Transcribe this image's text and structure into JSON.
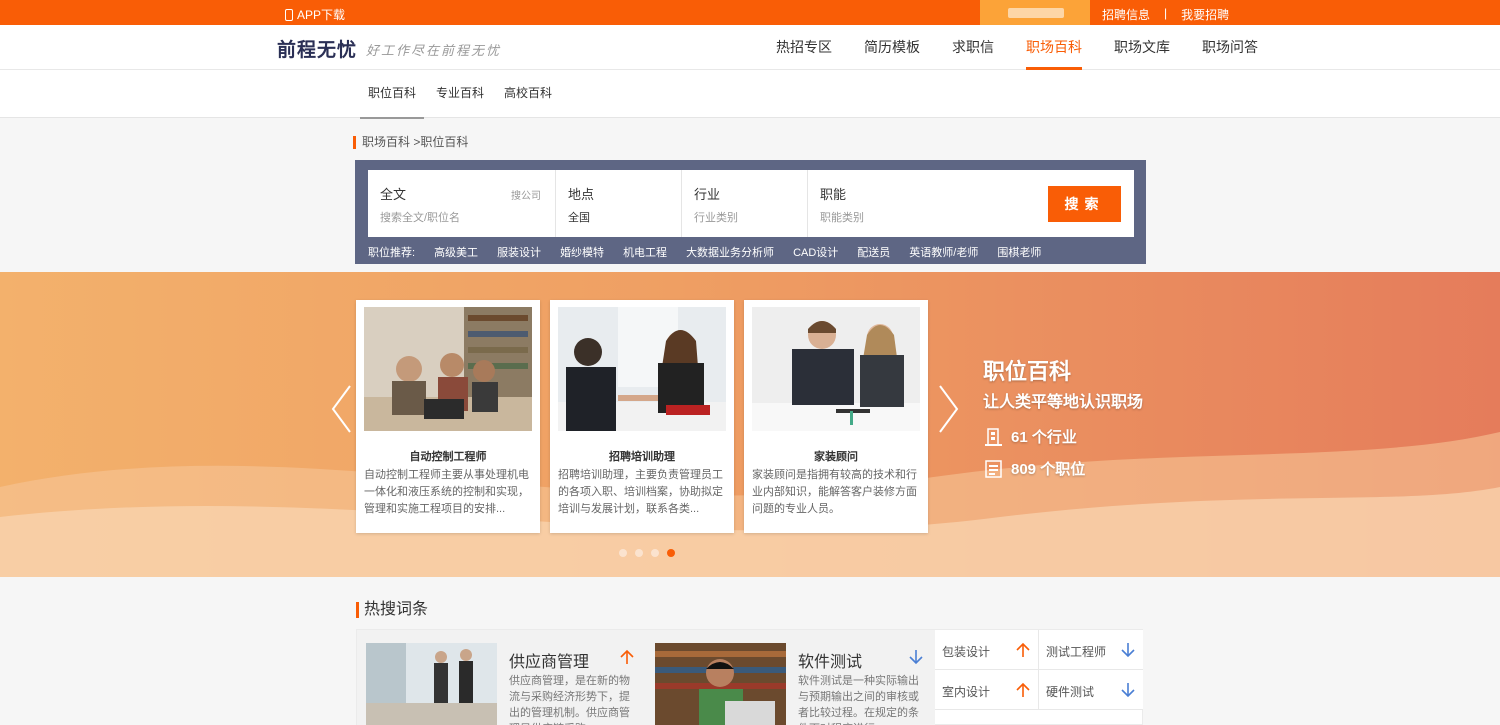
{
  "topbar": {
    "app_download": "APP下载",
    "links": [
      "招聘信息",
      "|",
      "我要招聘"
    ]
  },
  "header": {
    "logo": "前程无忧",
    "slogan": "好工作尽在前程无忧",
    "nav": [
      "热招专区",
      "简历模板",
      "求职信",
      "职场百科",
      "职场文库",
      "职场问答"
    ],
    "active_nav": "职场百科"
  },
  "subtabs": [
    "职位百科",
    "专业百科",
    "高校百科"
  ],
  "breadcrumb": "职场百科 >职位百科",
  "search": {
    "fulltext_label": "全文",
    "fulltext_aside": "搜公司",
    "fulltext_placeholder": "搜索全文/职位名",
    "location_label": "地点",
    "location_value": "全国",
    "industry_label": "行业",
    "industry_placeholder": "行业类别",
    "function_label": "职能",
    "function_placeholder": "职能类别",
    "button": "搜索",
    "recommend_label": "职位推荐:",
    "recommend": [
      "高级美工",
      "服装设计",
      "婚纱模特",
      "机电工程",
      "大数据业务分析师",
      "CAD设计",
      "配送员",
      "英语教师/老师",
      "围棋老师"
    ]
  },
  "banner": {
    "cards": [
      {
        "title": "自动控制工程师",
        "desc": "自动控制工程师主要从事处理机电一体化和液压系统的控制和实现，管理和实施工程项目的安排..."
      },
      {
        "title": "招聘培训助理",
        "desc": "招聘培训助理，主要负责管理员工的各项入职、培训档案，协助拟定培训与发展计划，联系各类..."
      },
      {
        "title": "家装顾问",
        "desc": "家装顾问是指拥有较高的技术和行业内部知识，能解答客户装修方面问题的专业人员。"
      }
    ],
    "title": "职位百科",
    "subtitle": "让人类平等地认识职场",
    "stats": [
      {
        "icon": "building-icon",
        "text": "61 个行业"
      },
      {
        "icon": "document-icon",
        "text": "809 个职位"
      }
    ],
    "dots_total": 4,
    "dots_active": 4
  },
  "hot": {
    "title": "热搜词条",
    "cards": [
      {
        "name": "供应商管理",
        "trend": "up",
        "text": "供应商管理，是在新的物流与采购经济形势下，提出的管理机制。供应商管理是供应链采购..."
      },
      {
        "name": "软件测试",
        "trend": "down",
        "text": "软件测试是一种实际输出与预期输出之间的审核或者比较过程。在规定的条件下对程序进行..."
      }
    ],
    "small": [
      {
        "name": "包装设计",
        "trend": "up"
      },
      {
        "name": "测试工程师",
        "trend": "down"
      },
      {
        "name": "室内设计",
        "trend": "up"
      },
      {
        "name": "硬件测试",
        "trend": "down"
      }
    ]
  },
  "colors": {
    "brand": "#f95d06",
    "search_bg": "#5e6684",
    "trend_up": "#f95d06",
    "trend_down": "#4a7fd4"
  }
}
